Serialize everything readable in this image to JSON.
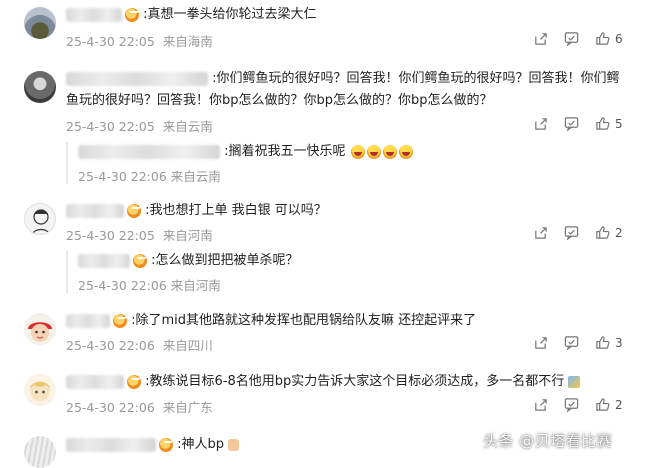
{
  "comments": [
    {
      "text": ":真想一拳头给你轮过去梁大仁",
      "date": "25-4-30 22:05",
      "location": "来自海南",
      "likes": "6"
    },
    {
      "text1": ":你们鳄鱼玩的很好吗？回答我！你们鳄鱼玩的很好吗？回答我！你们鳄",
      "text2": "鱼玩的很好吗？回答我！你bp怎么做的？你bp怎么做的？你bp怎么做的？",
      "date": "25-4-30 22:05",
      "location": "来自云南",
      "likes": "5",
      "reply": {
        "text": ":搁着祝我五一快乐呢",
        "date": "25-4-30 22:06",
        "location": "来自云南"
      }
    },
    {
      "text": ":我也想打上单  我白银 可以吗？",
      "date": "25-4-30 22:05",
      "location": "来自河南",
      "likes": "2",
      "reply": {
        "text": ":怎么做到把把被单杀呢？",
        "date": "25-4-30 22:06",
        "location": "来自河南"
      }
    },
    {
      "text": ":除了mid其他路就这种发挥也配甩锅给队友嘛 还控起评来了",
      "date": "25-4-30 22:06",
      "location": "来自四川",
      "likes": "3"
    },
    {
      "text": ":教练说目标6-8名他用bp实力告诉大家这个目标必须达成，多一名都不行",
      "date": "25-4-30 22:06",
      "location": "来自广东",
      "likes": "2"
    },
    {
      "text": ":神人bp"
    }
  ],
  "watermark": "头条 @贝塔看比赛"
}
